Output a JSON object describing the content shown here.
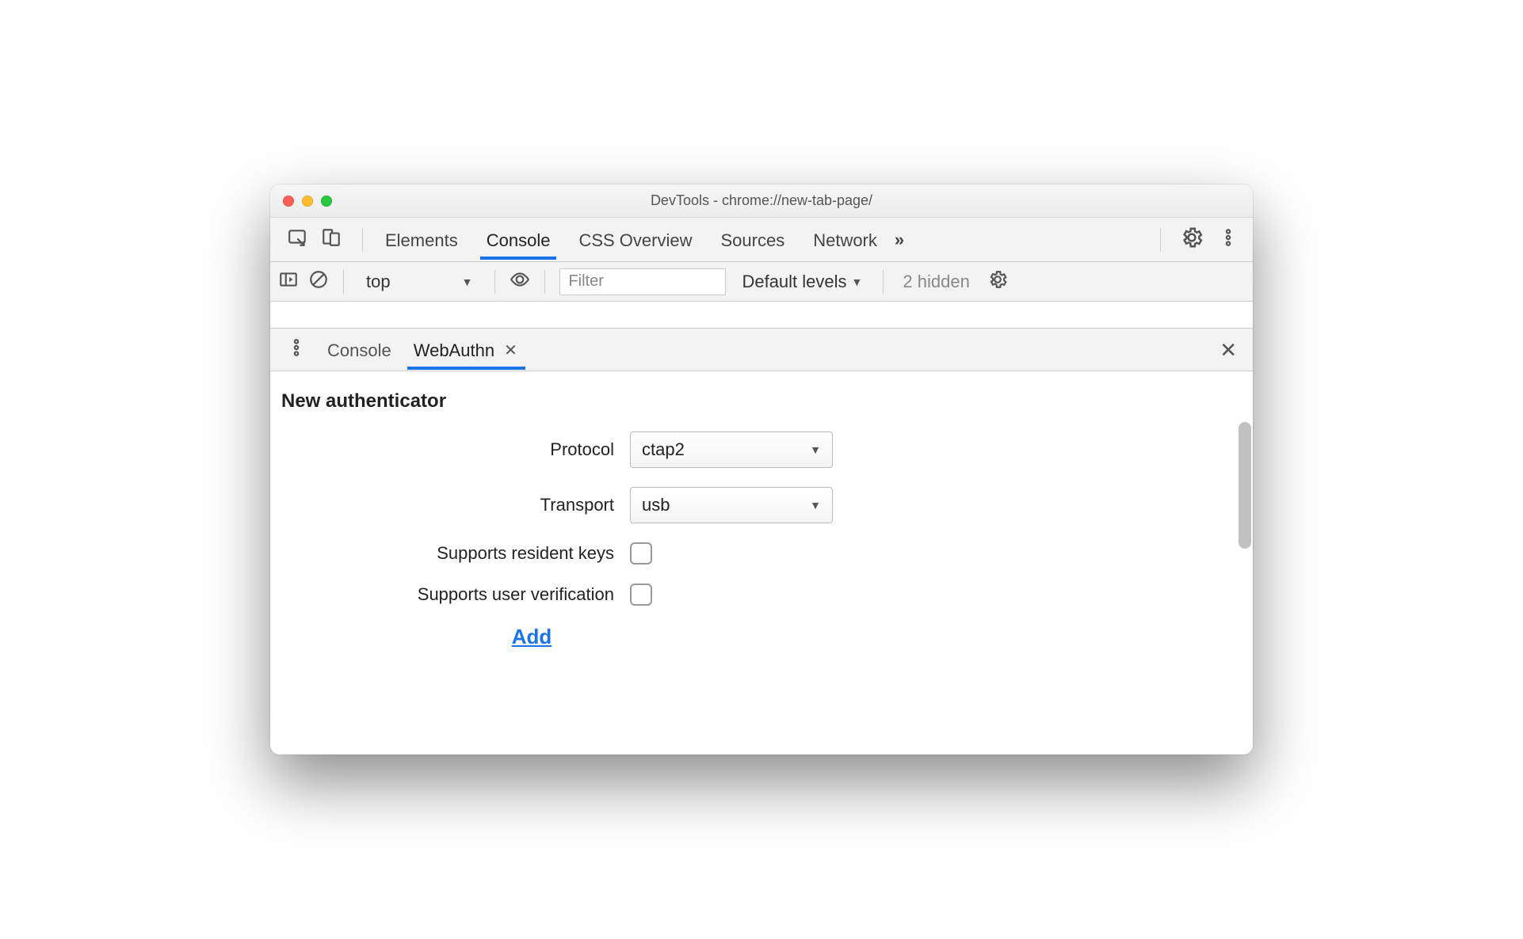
{
  "window": {
    "title": "DevTools - chrome://new-tab-page/"
  },
  "tabs": {
    "elements": "Elements",
    "console": "Console",
    "css_overview": "CSS Overview",
    "sources": "Sources",
    "network": "Network"
  },
  "console_toolbar": {
    "context": "top",
    "filter_placeholder": "Filter",
    "levels": "Default levels",
    "hidden": "2 hidden"
  },
  "drawer": {
    "tab_console": "Console",
    "tab_webauthn": "WebAuthn"
  },
  "webauthn": {
    "heading": "New authenticator",
    "protocol_label": "Protocol",
    "protocol_value": "ctap2",
    "transport_label": "Transport",
    "transport_value": "usb",
    "resident_label": "Supports resident keys",
    "userverify_label": "Supports user verification",
    "add_label": "Add"
  }
}
